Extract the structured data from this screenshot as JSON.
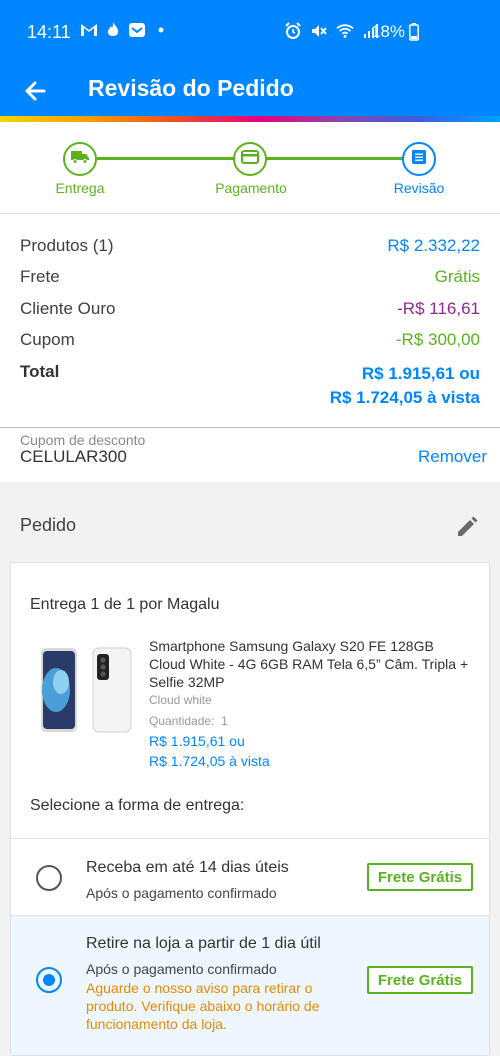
{
  "status_bar": {
    "time": "14:11",
    "battery": "18%",
    "icons": [
      "gmail-icon",
      "flame-icon",
      "mail-badge-icon",
      "dot-icon",
      "alarm-icon",
      "mute-icon",
      "wifi-icon",
      "signal-icon",
      "battery-icon"
    ]
  },
  "app_bar": {
    "title": "Revisão do Pedido",
    "back_icon": "arrow-left-icon"
  },
  "colors": {
    "brand": "#0086ff",
    "success": "#5ab31e",
    "discount": "#8e2a8e",
    "warning": "#e58b00"
  },
  "steps": [
    {
      "label": "Entrega",
      "icon": "truck-icon",
      "state": "done"
    },
    {
      "label": "Pagamento",
      "icon": "card-icon",
      "state": "done"
    },
    {
      "label": "Revisão",
      "icon": "document-icon",
      "state": "active"
    }
  ],
  "summary": {
    "products_label": "Produtos (1)",
    "products_value": "R$ 2.332,22",
    "freight_label": "Frete",
    "freight_value": "Grátis",
    "gold_label": "Cliente Ouro",
    "gold_value": "-R$ 116,61",
    "coupon_label": "Cupom",
    "coupon_value": "-R$ 300,00",
    "total_label": "Total",
    "total_value_1": "R$ 1.915,61 ou",
    "total_value_2": "R$ 1.724,05 à vista"
  },
  "coupon": {
    "caption": "Cupom de desconto",
    "code": "CELULAR300",
    "remove_label": "Remover"
  },
  "order": {
    "header": "Pedido",
    "edit_icon": "pencil-icon",
    "shipment_title": "Entrega 1 de 1 por Magalu",
    "product": {
      "name": "Smartphone Samsung Galaxy S20 FE 128GB Cloud White - 4G 6GB RAM Tela 6,5” Câm. Tripla + Selfie 32MP",
      "color": "Cloud white",
      "quantity_label": "Quantidade:",
      "quantity": "1",
      "price_1": "R$ 1.915,61 ou",
      "price_2": "R$ 1.724,05 à vista"
    },
    "delivery_title": "Selecione a forma de entrega:",
    "options": [
      {
        "title": "Receba em até 14 dias úteis",
        "subtitle": "Após o pagamento confirmado",
        "badge": "Frete Grátis",
        "selected": false
      },
      {
        "title": "Retire na loja a partir de 1 dia útil",
        "subtitle": "Após o pagamento confirmado",
        "warning": "Aguarde o nosso aviso para retirar o produto. Verifique abaixo o horário de funcionamento da loja.",
        "badge": "Frete Grátis",
        "selected": true
      }
    ]
  }
}
